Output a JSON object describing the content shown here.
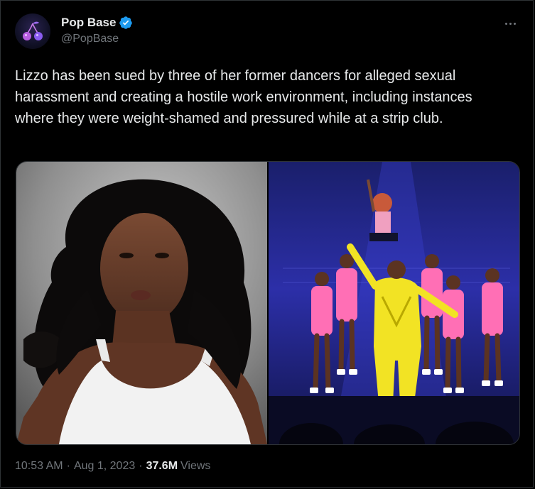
{
  "author": {
    "display_name": "Pop Base",
    "handle": "@PopBase",
    "verified": true,
    "avatar_icon": "cherry-logo-icon"
  },
  "menu_icon": "more-options-icon",
  "tweet": {
    "text": "Lizzo has been sued by three of her former dancers for alleged sexual harassment and creating a hostile work environment, including instances where they were weight-shamed and pressured while at a strip club."
  },
  "media": [
    {
      "kind": "photo",
      "subject": "portrait-photo"
    },
    {
      "kind": "photo",
      "subject": "concert-stage-photo"
    }
  ],
  "meta": {
    "time": "10:53 AM",
    "separator": "·",
    "date": "Aug 1, 2023",
    "views_count": "37.6M",
    "views_label": "Views"
  },
  "colors": {
    "background": "#000000",
    "text_primary": "#e7e9ea",
    "text_secondary": "#71767b",
    "border": "#2f3336",
    "verified_blue": "#1d9bf0"
  }
}
